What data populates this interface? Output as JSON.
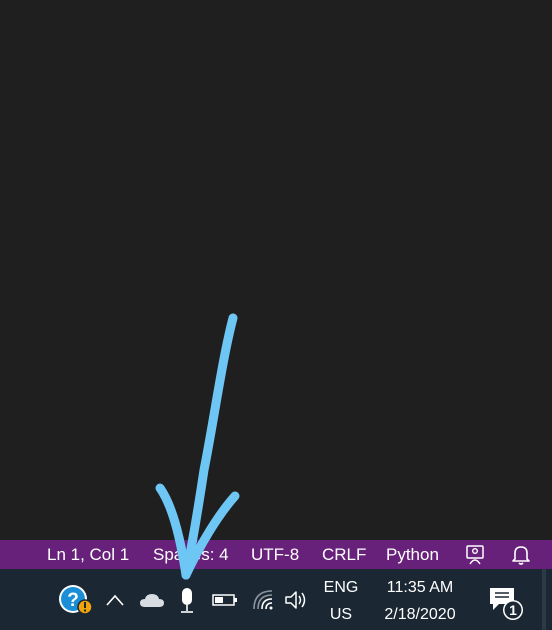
{
  "colors": {
    "editor_background": "#1f1f1f",
    "statusbar_background": "#68217a",
    "taskbar_background": "#1b2733",
    "annotation_arrow": "#6ec6f5"
  },
  "statusbar": {
    "cursor_position": "Ln 1, Col 1",
    "indentation": "Spaces: 4",
    "encoding": "UTF-8",
    "line_ending": "CRLF",
    "language": "Python",
    "feedback_icon": "feedback-person-icon",
    "notifications_icon": "bell-icon"
  },
  "taskbar": {
    "tray_icons": [
      "help-icon",
      "chevron-up-icon",
      "onedrive-cloud-icon",
      "microphone-icon",
      "battery-icon",
      "wifi-icon",
      "volume-icon"
    ],
    "language": "ENG",
    "region": "US",
    "time": "11:35 AM",
    "date": "2/18/2020",
    "notification_count": "1"
  }
}
